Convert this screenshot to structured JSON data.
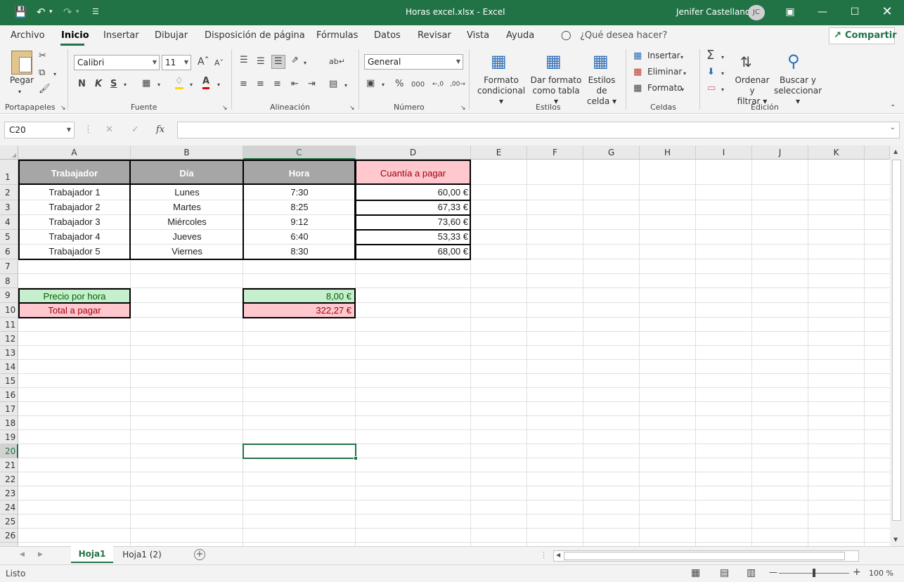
{
  "titlebar": {
    "title": "Horas excel.xlsx  -  Excel",
    "user": "Jenifer Castellano",
    "initials": "JC"
  },
  "menu": {
    "items": [
      "Archivo",
      "Inicio",
      "Insertar",
      "Dibujar",
      "Disposición de página",
      "Fórmulas",
      "Datos",
      "Revisar",
      "Vista",
      "Ayuda"
    ],
    "search": "¿Qué desea hacer?",
    "share": "Compartir"
  },
  "ribbon": {
    "paste": "Pegar",
    "font_name": "Calibri",
    "font_size": "11",
    "bold": "N",
    "italic": "K",
    "underline": "S",
    "number_format": "General",
    "cond_format": [
      "Formato",
      "condicional"
    ],
    "table_format": [
      "Dar formato",
      "como tabla"
    ],
    "cell_styles": [
      "Estilos de",
      "celda"
    ],
    "insert": "Insertar",
    "delete": "Eliminar",
    "format": "Formato",
    "sort_filter": [
      "Ordenar y",
      "filtrar"
    ],
    "find_select": [
      "Buscar y",
      "seleccionar"
    ],
    "groups": [
      "Portapapeles",
      "Fuente",
      "Alineación",
      "Número",
      "Estilos",
      "Celdas",
      "Edición"
    ]
  },
  "formula_bar": {
    "name_box": "C20",
    "fx": "fx",
    "value": ""
  },
  "sheet": {
    "columns": [
      "A",
      "B",
      "C",
      "D",
      "E",
      "F",
      "G",
      "H",
      "I",
      "J",
      "K"
    ],
    "rows": [
      "1",
      "2",
      "3",
      "4",
      "5",
      "6",
      "7",
      "8",
      "9",
      "10",
      "11",
      "12",
      "13",
      "14",
      "15",
      "16",
      "17",
      "18",
      "19",
      "20",
      "21",
      "22",
      "23",
      "24",
      "25",
      "26"
    ],
    "header": [
      "Trabajador",
      "Día",
      "Hora",
      "Cuantía a pagar"
    ],
    "data": [
      [
        "Trabajador 1",
        "Lunes",
        "7:30",
        "60,00 €"
      ],
      [
        "Trabajador 2",
        "Martes",
        "8:25",
        "67,33 €"
      ],
      [
        "Trabajador 3",
        "Miércoles",
        "9:12",
        "73,60 €"
      ],
      [
        "Trabajador 4",
        "Jueves",
        "6:40",
        "53,33 €"
      ],
      [
        "Trabajador 5",
        "Viernes",
        "8:30",
        "68,00 €"
      ]
    ],
    "price_label": "Precio por hora",
    "price_value": "8,00 €",
    "total_label": "Total a pagar",
    "total_value": "322,27 €",
    "selected_cell": "C20"
  },
  "tabs": {
    "items": [
      "Hoja1",
      "Hoja1 (2)"
    ],
    "active": "Hoja1"
  },
  "status": {
    "text": "Listo",
    "zoom": "100 %"
  },
  "colors": {
    "excel_green": "#217346",
    "header_gray": "#a6a6a6",
    "pink": "#ffc7ce",
    "pink_text": "#9c0006",
    "green_fill": "#c6efce",
    "green_text": "#006100"
  }
}
